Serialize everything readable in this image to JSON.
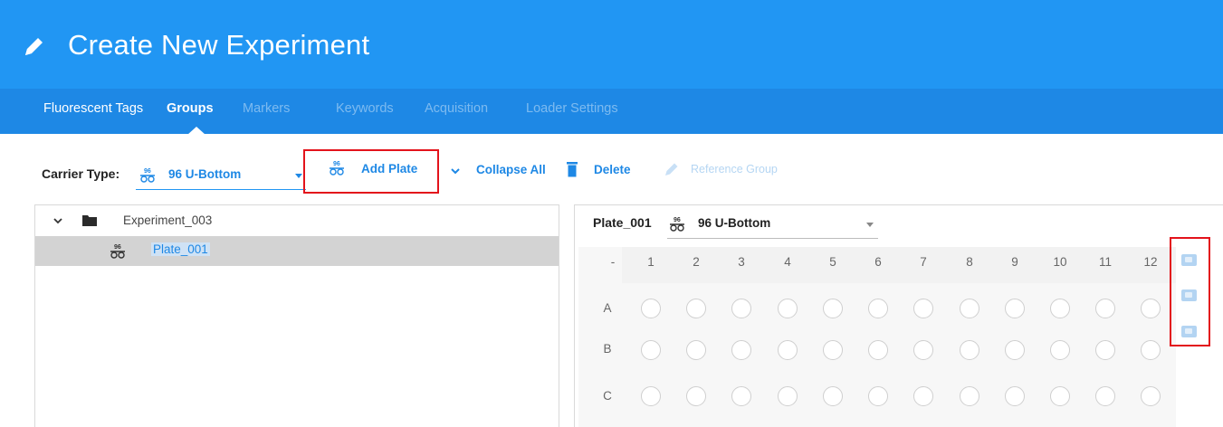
{
  "header": {
    "title": "Create New Experiment"
  },
  "tabs": [
    {
      "label": "Fluorescent Tags",
      "state": "enabled"
    },
    {
      "label": "Groups",
      "state": "active"
    },
    {
      "label": "Markers",
      "state": "disabled"
    },
    {
      "label": "Keywords",
      "state": "disabled"
    },
    {
      "label": "Acquisition",
      "state": "disabled"
    },
    {
      "label": "Loader Settings",
      "state": "disabled"
    }
  ],
  "toolbar": {
    "carrier_label": "Carrier Type:",
    "carrier_value": "96 U-Bottom",
    "add_plate": "Add Plate",
    "collapse_all": "Collapse All",
    "delete": "Delete",
    "reference_group": "Reference Group"
  },
  "tree": {
    "experiment": "Experiment_003",
    "plate": "Plate_001"
  },
  "plate_panel": {
    "name": "Plate_001",
    "type": "96 U-Bottom",
    "corner": "-",
    "columns": [
      "1",
      "2",
      "3",
      "4",
      "5",
      "6",
      "7",
      "8",
      "9",
      "10",
      "11",
      "12"
    ],
    "rows": [
      "A",
      "B",
      "C"
    ]
  },
  "colors": {
    "header": "#2196f3",
    "tabbar": "#1e88e5",
    "accent": "#1e88e5",
    "highlight": "#e3131b"
  },
  "icons": [
    "pencil-icon",
    "plate-icon",
    "chevron-down-icon",
    "trash-icon",
    "folder-icon",
    "side-panel-icon"
  ]
}
